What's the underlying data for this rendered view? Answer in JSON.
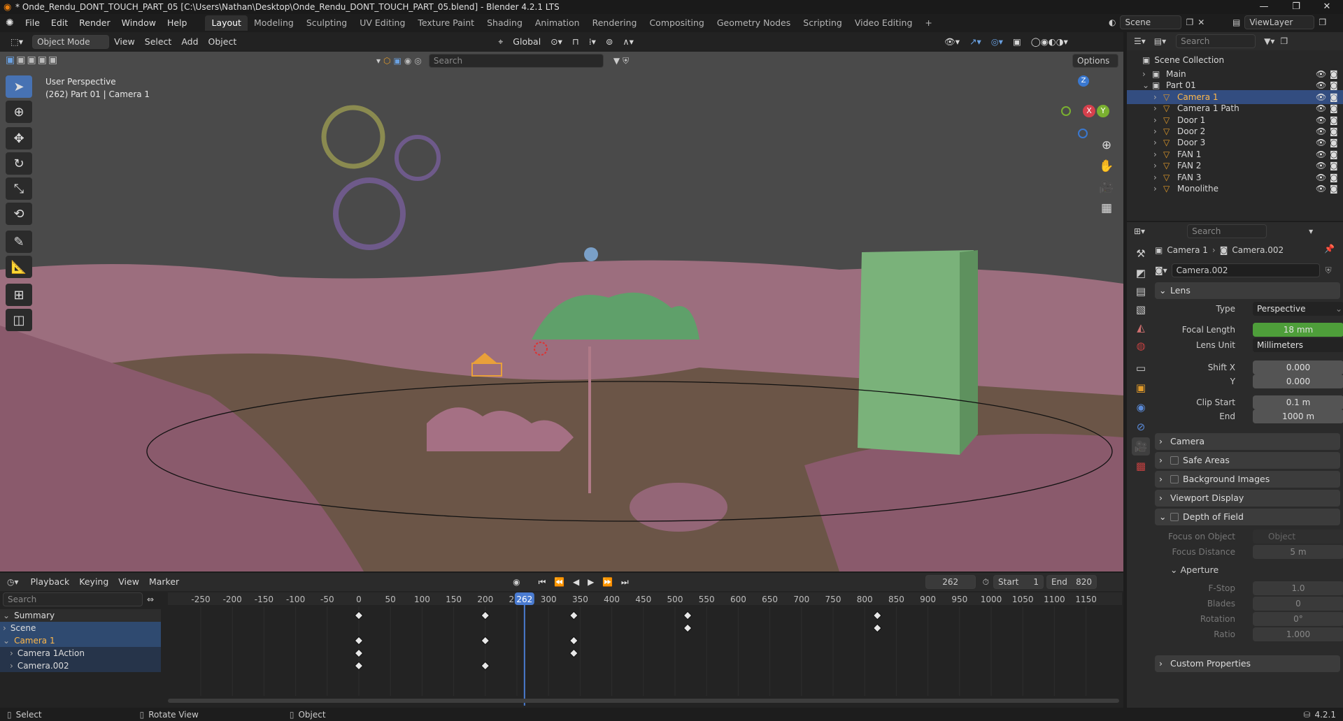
{
  "titlebar": {
    "title": "* Onde_Rendu_DONT_TOUCH_PART_05 [C:\\Users\\Nathan\\Desktop\\Onde_Rendu_DONT_TOUCH_PART_05.blend] - Blender 4.2.1 LTS"
  },
  "menu": {
    "items": [
      "File",
      "Edit",
      "Render",
      "Window",
      "Help"
    ]
  },
  "workspaces": [
    "Layout",
    "Modeling",
    "Sculpting",
    "UV Editing",
    "Texture Paint",
    "Shading",
    "Animation",
    "Rendering",
    "Compositing",
    "Geometry Nodes",
    "Scripting",
    "Video Editing"
  ],
  "workspace_add": "+",
  "scene": {
    "name": "Scene",
    "view_layer": "ViewLayer"
  },
  "viewport": {
    "mode": "Object Mode",
    "menus": [
      "View",
      "Select",
      "Add",
      "Object"
    ],
    "orientation": "Global",
    "search_placeholder": "Search",
    "options_label": "Options",
    "info_line1": "User Perspective",
    "info_line2": "(262) Part 01 | Camera 1",
    "gizmo": {
      "z": "Z",
      "x": "X",
      "y": "Y"
    }
  },
  "outliner": {
    "search_placeholder": "Search",
    "root": "Scene Collection",
    "rows": [
      {
        "name": "Main",
        "indent": 1
      },
      {
        "name": "Part 01",
        "indent": 1
      },
      {
        "name": "Camera 1",
        "indent": 2,
        "selected": true
      },
      {
        "name": "Camera 1 Path",
        "indent": 2
      },
      {
        "name": "Door 1",
        "indent": 2
      },
      {
        "name": "Door 2",
        "indent": 2
      },
      {
        "name": "Door 3",
        "indent": 2
      },
      {
        "name": "FAN 1",
        "indent": 2
      },
      {
        "name": "FAN 2",
        "indent": 2
      },
      {
        "name": "FAN 3",
        "indent": 2
      },
      {
        "name": "Monolithe",
        "indent": 2
      }
    ]
  },
  "properties": {
    "search_placeholder": "Search",
    "breadcrumb_object": "Camera 1",
    "breadcrumb_data": "Camera.002",
    "datablock": "Camera.002",
    "lens_panel": "Lens",
    "type_label": "Type",
    "type_value": "Perspective",
    "focal_label": "Focal Length",
    "focal_value": "18 mm",
    "lens_unit_label": "Lens Unit",
    "lens_unit_value": "Millimeters",
    "shift_x_label": "Shift X",
    "shift_x_value": "0.000",
    "shift_y_label": "Y",
    "shift_y_value": "0.000",
    "clip_start_label": "Clip Start",
    "clip_start_value": "0.1 m",
    "clip_end_label": "End",
    "clip_end_value": "1000 m",
    "panels": [
      "Camera",
      "Safe Areas",
      "Background Images",
      "Viewport Display",
      "Depth of Field"
    ],
    "focus_object_label": "Focus on Object",
    "focus_object_placeholder": "Object",
    "focus_distance_label": "Focus Distance",
    "focus_distance_value": "5 m",
    "aperture_label": "Aperture",
    "fstop_label": "F-Stop",
    "fstop_value": "1.0",
    "blades_label": "Blades",
    "blades_value": "0",
    "rotation_label": "Rotation",
    "rotation_value": "0°",
    "ratio_label": "Ratio",
    "ratio_value": "1.000",
    "custom_props": "Custom Properties"
  },
  "timeline": {
    "menus": [
      "Playback",
      "Keying",
      "View",
      "Marker"
    ],
    "current_frame": "262",
    "start_label": "Start",
    "start_value": "1",
    "end_label": "End",
    "end_value": "820",
    "search_placeholder": "Search",
    "frame_labels": [
      "-250",
      "-200",
      "-150",
      "-100",
      "-50",
      "0",
      "50",
      "100",
      "150",
      "200",
      "250",
      "300",
      "350",
      "400",
      "450",
      "500",
      "550",
      "600",
      "650",
      "700",
      "750",
      "800",
      "850",
      "900",
      "950",
      "1000",
      "1050",
      "1100",
      "1150"
    ],
    "channels": [
      "Summary",
      "Scene",
      "Camera 1",
      "Camera 1Action",
      "Camera.002"
    ],
    "keyframes": {
      "Summary": [
        0,
        200,
        340,
        520,
        820
      ],
      "Scene": [
        520,
        820
      ],
      "Camera 1": [
        0,
        200,
        340
      ],
      "Camera 1Action": [
        0,
        340
      ],
      "Camera.002": [
        0,
        200
      ]
    }
  },
  "statusbar": {
    "select": "Select",
    "rotate": "Rotate View",
    "object": "Object",
    "version": "4.2.1"
  }
}
